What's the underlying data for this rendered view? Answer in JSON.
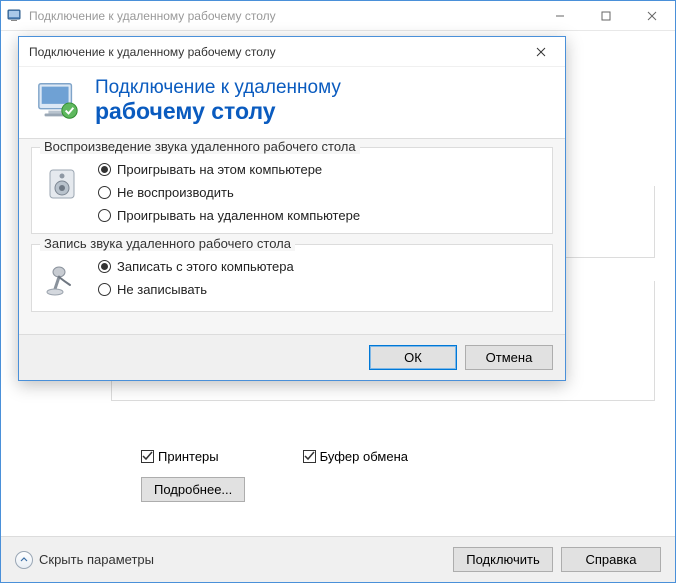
{
  "parent": {
    "title": "Подключение к удаленному рабочему столу",
    "checks": {
      "printers": "Принтеры",
      "clipboard": "Буфер обмена"
    },
    "details": "Подробнее...",
    "collapse": "Скрыть параметры",
    "connect": "Подключить",
    "help": "Справка"
  },
  "dialog": {
    "title": "Подключение к удаленному рабочему столу",
    "banner_line1": "Подключение к удаленному",
    "banner_line2": "рабочему столу",
    "group_playback": {
      "legend": "Воспроизведение звука удаленного рабочего стола",
      "opt_local": "Проигрывать на этом компьютере",
      "opt_none": "Не воспроизводить",
      "opt_remote": "Проигрывать на удаленном компьютере",
      "selected": "opt_local"
    },
    "group_record": {
      "legend": "Запись звука удаленного рабочего стола",
      "opt_record": "Записать с этого компьютера",
      "opt_none": "Не записывать",
      "selected": "opt_record"
    },
    "ok": "ОК",
    "cancel": "Отмена"
  }
}
